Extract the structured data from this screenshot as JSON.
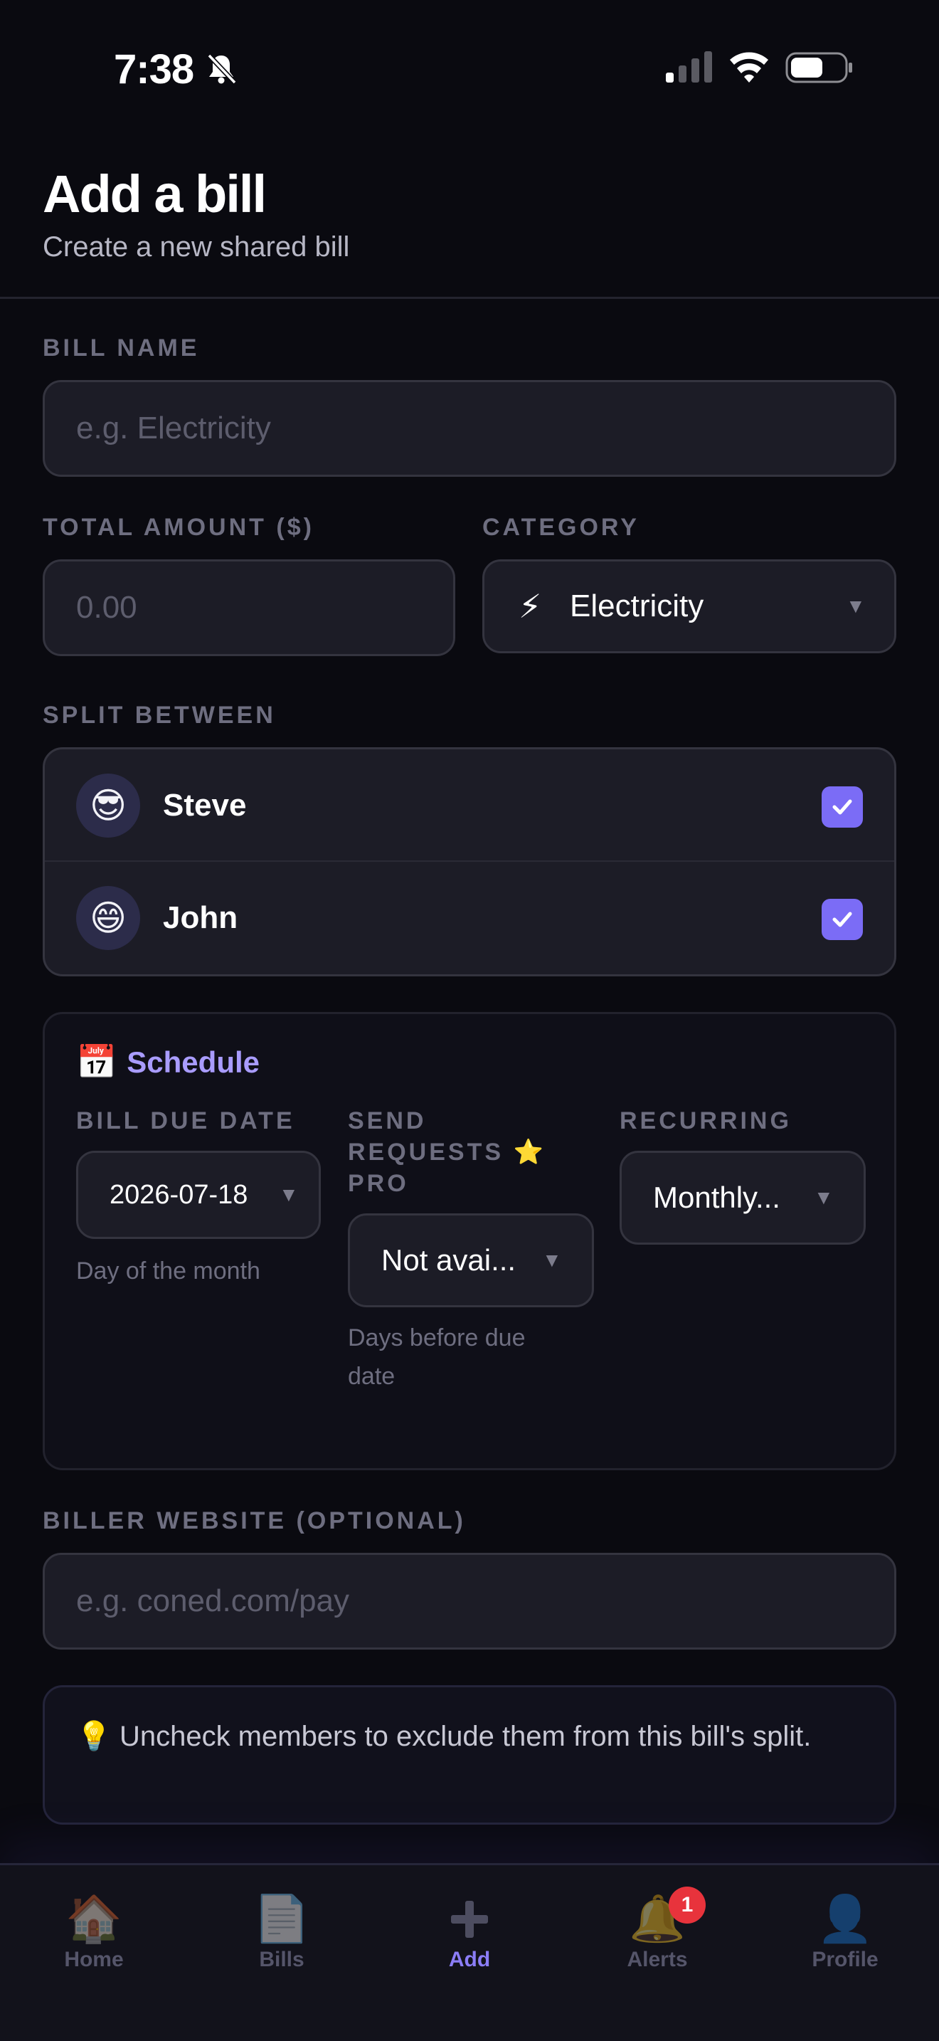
{
  "status_bar": {
    "time": "7:38"
  },
  "header": {
    "title": "Add a bill",
    "subtitle": "Create a new shared bill"
  },
  "form": {
    "bill_name": {
      "label": "BILL NAME",
      "placeholder": "e.g. Electricity",
      "value": ""
    },
    "total_amount": {
      "label": "TOTAL AMOUNT ($)",
      "placeholder": "0.00",
      "value": ""
    },
    "category": {
      "label": "CATEGORY",
      "icon": "⚡",
      "value": "Electricity"
    },
    "split_between": {
      "label": "SPLIT BETWEEN",
      "members": [
        {
          "emoji": "😎",
          "name": "Steve",
          "checked": true
        },
        {
          "emoji": "😄",
          "name": "John",
          "checked": true
        }
      ]
    },
    "schedule": {
      "icon": "📅",
      "title": "Schedule",
      "due_date": {
        "label": "BILL DUE DATE",
        "value": "2026-07-18",
        "hint": "Day of the month"
      },
      "send_requests": {
        "label_line1": "SEND",
        "label_line2": "REQUESTS ⭐",
        "label_line3": "PRO",
        "value": "Not avai...",
        "hint_line1": "Days before due",
        "hint_line2": "date"
      },
      "recurring": {
        "label": "RECURRING",
        "value": "Monthly..."
      }
    },
    "biller_website": {
      "label": "BILLER WEBSITE (OPTIONAL)",
      "placeholder": "e.g. coned.com/pay",
      "value": ""
    },
    "tip": {
      "icon": "💡",
      "text": "Uncheck members to exclude them from this bill's split."
    }
  },
  "tabbar": {
    "tabs": [
      {
        "icon": "🏠",
        "label": "Home"
      },
      {
        "icon": "📄",
        "label": "Bills"
      },
      {
        "icon": "➕",
        "label": "Add",
        "active": true
      },
      {
        "icon": "🔔",
        "label": "Alerts",
        "badge": "1"
      },
      {
        "icon": "👤",
        "label": "Profile"
      }
    ]
  },
  "colors": {
    "accent": "#7b6cf6",
    "schedule_title": "#a99cff",
    "badge": "#e8333c",
    "background": "#0a0a10"
  }
}
